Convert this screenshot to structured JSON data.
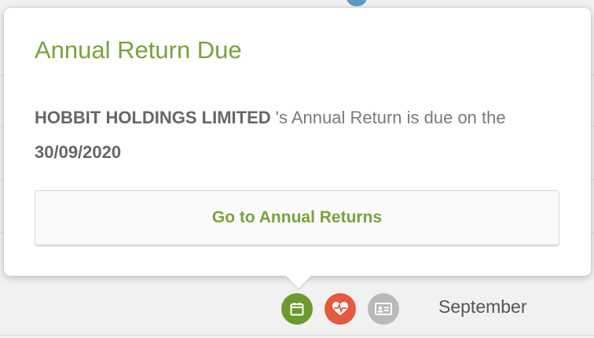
{
  "popover": {
    "title": "Annual Return Due",
    "company_name": "HOBBIT HOLDINGS LIMITED",
    "message_middle": " 's Annual Return is due on the ",
    "due_date": "30/09/2020",
    "button_label": "Go to Annual Returns"
  },
  "footer": {
    "icons": [
      "calendar-icon",
      "heart-pulse-icon",
      "id-card-icon"
    ],
    "month_label": "September"
  },
  "colors": {
    "accent": "#7aa23a",
    "calendar_bg": "#6c9a2f",
    "heart_bg": "#e35a3e",
    "id_bg": "#b9b9b9"
  }
}
